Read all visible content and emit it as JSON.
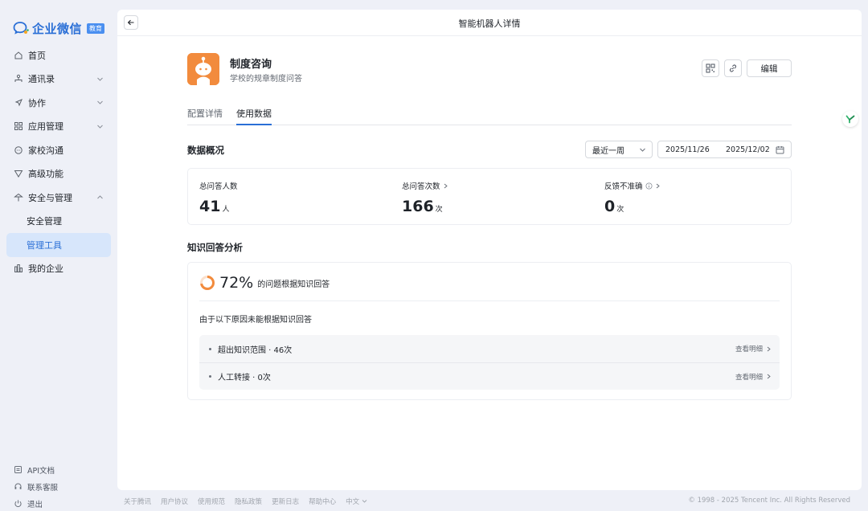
{
  "brand": {
    "name": "企业微信",
    "badge": "教育",
    "color": "#2a6fd6"
  },
  "sidebar": {
    "items": [
      {
        "label": "首页",
        "icon": "home-icon"
      },
      {
        "label": "通讯录",
        "icon": "contacts-icon",
        "expandable": true
      },
      {
        "label": "协作",
        "icon": "collab-icon",
        "expandable": true
      },
      {
        "label": "应用管理",
        "icon": "apps-icon",
        "expandable": true
      },
      {
        "label": "家校沟通",
        "icon": "chat-icon"
      },
      {
        "label": "高级功能",
        "icon": "advanced-icon"
      },
      {
        "label": "安全与管理",
        "icon": "security-icon",
        "expanded": true
      },
      {
        "label": "安全管理",
        "sub": true
      },
      {
        "label": "管理工具",
        "sub": true,
        "active": true
      },
      {
        "label": "我的企业",
        "icon": "company-icon"
      }
    ],
    "bottom": [
      {
        "label": "API文档",
        "icon": "doc-icon"
      },
      {
        "label": "联系客服",
        "icon": "headset-icon"
      },
      {
        "label": "退出",
        "icon": "power-icon"
      }
    ]
  },
  "header": {
    "title": "智能机器人详情"
  },
  "bot": {
    "name": "制度咨询",
    "description": "学校的规章制度问答"
  },
  "actions": {
    "edit_label": "编辑"
  },
  "tabs": [
    {
      "label": "配置详情",
      "active": false
    },
    {
      "label": "使用数据",
      "active": true
    }
  ],
  "overview": {
    "title": "数据概况",
    "period_select": "最近一周",
    "date_start": "2025/11/26",
    "date_end": "2025/12/02",
    "stats": [
      {
        "label": "总问答人数",
        "value": "41",
        "unit": "人",
        "arrow": false,
        "info": false
      },
      {
        "label": "总问答次数",
        "value": "166",
        "unit": "次",
        "arrow": true,
        "info": false
      },
      {
        "label": "反馈不准确",
        "value": "0",
        "unit": "次",
        "arrow": true,
        "info": true
      }
    ]
  },
  "analysis": {
    "title": "知识回答分析",
    "percent": "72%",
    "percent_value": 0.72,
    "percent_text": "的问题根据知识回答",
    "reasons_title": "由于以下原因未能根据知识回答",
    "reasons": [
      {
        "text": "超出知识范围 · 46次",
        "link": "查看明细"
      },
      {
        "text": "人工转接 · 0次",
        "link": "查看明细"
      }
    ],
    "ring_color": "#f28b3d"
  },
  "footer": {
    "links": [
      "关于腾讯",
      "用户协议",
      "使用规范",
      "隐私政策",
      "更新日志",
      "帮助中心",
      "中文"
    ],
    "copyright": "© 1998 - 2025 Tencent Inc. All Rights Reserved"
  }
}
